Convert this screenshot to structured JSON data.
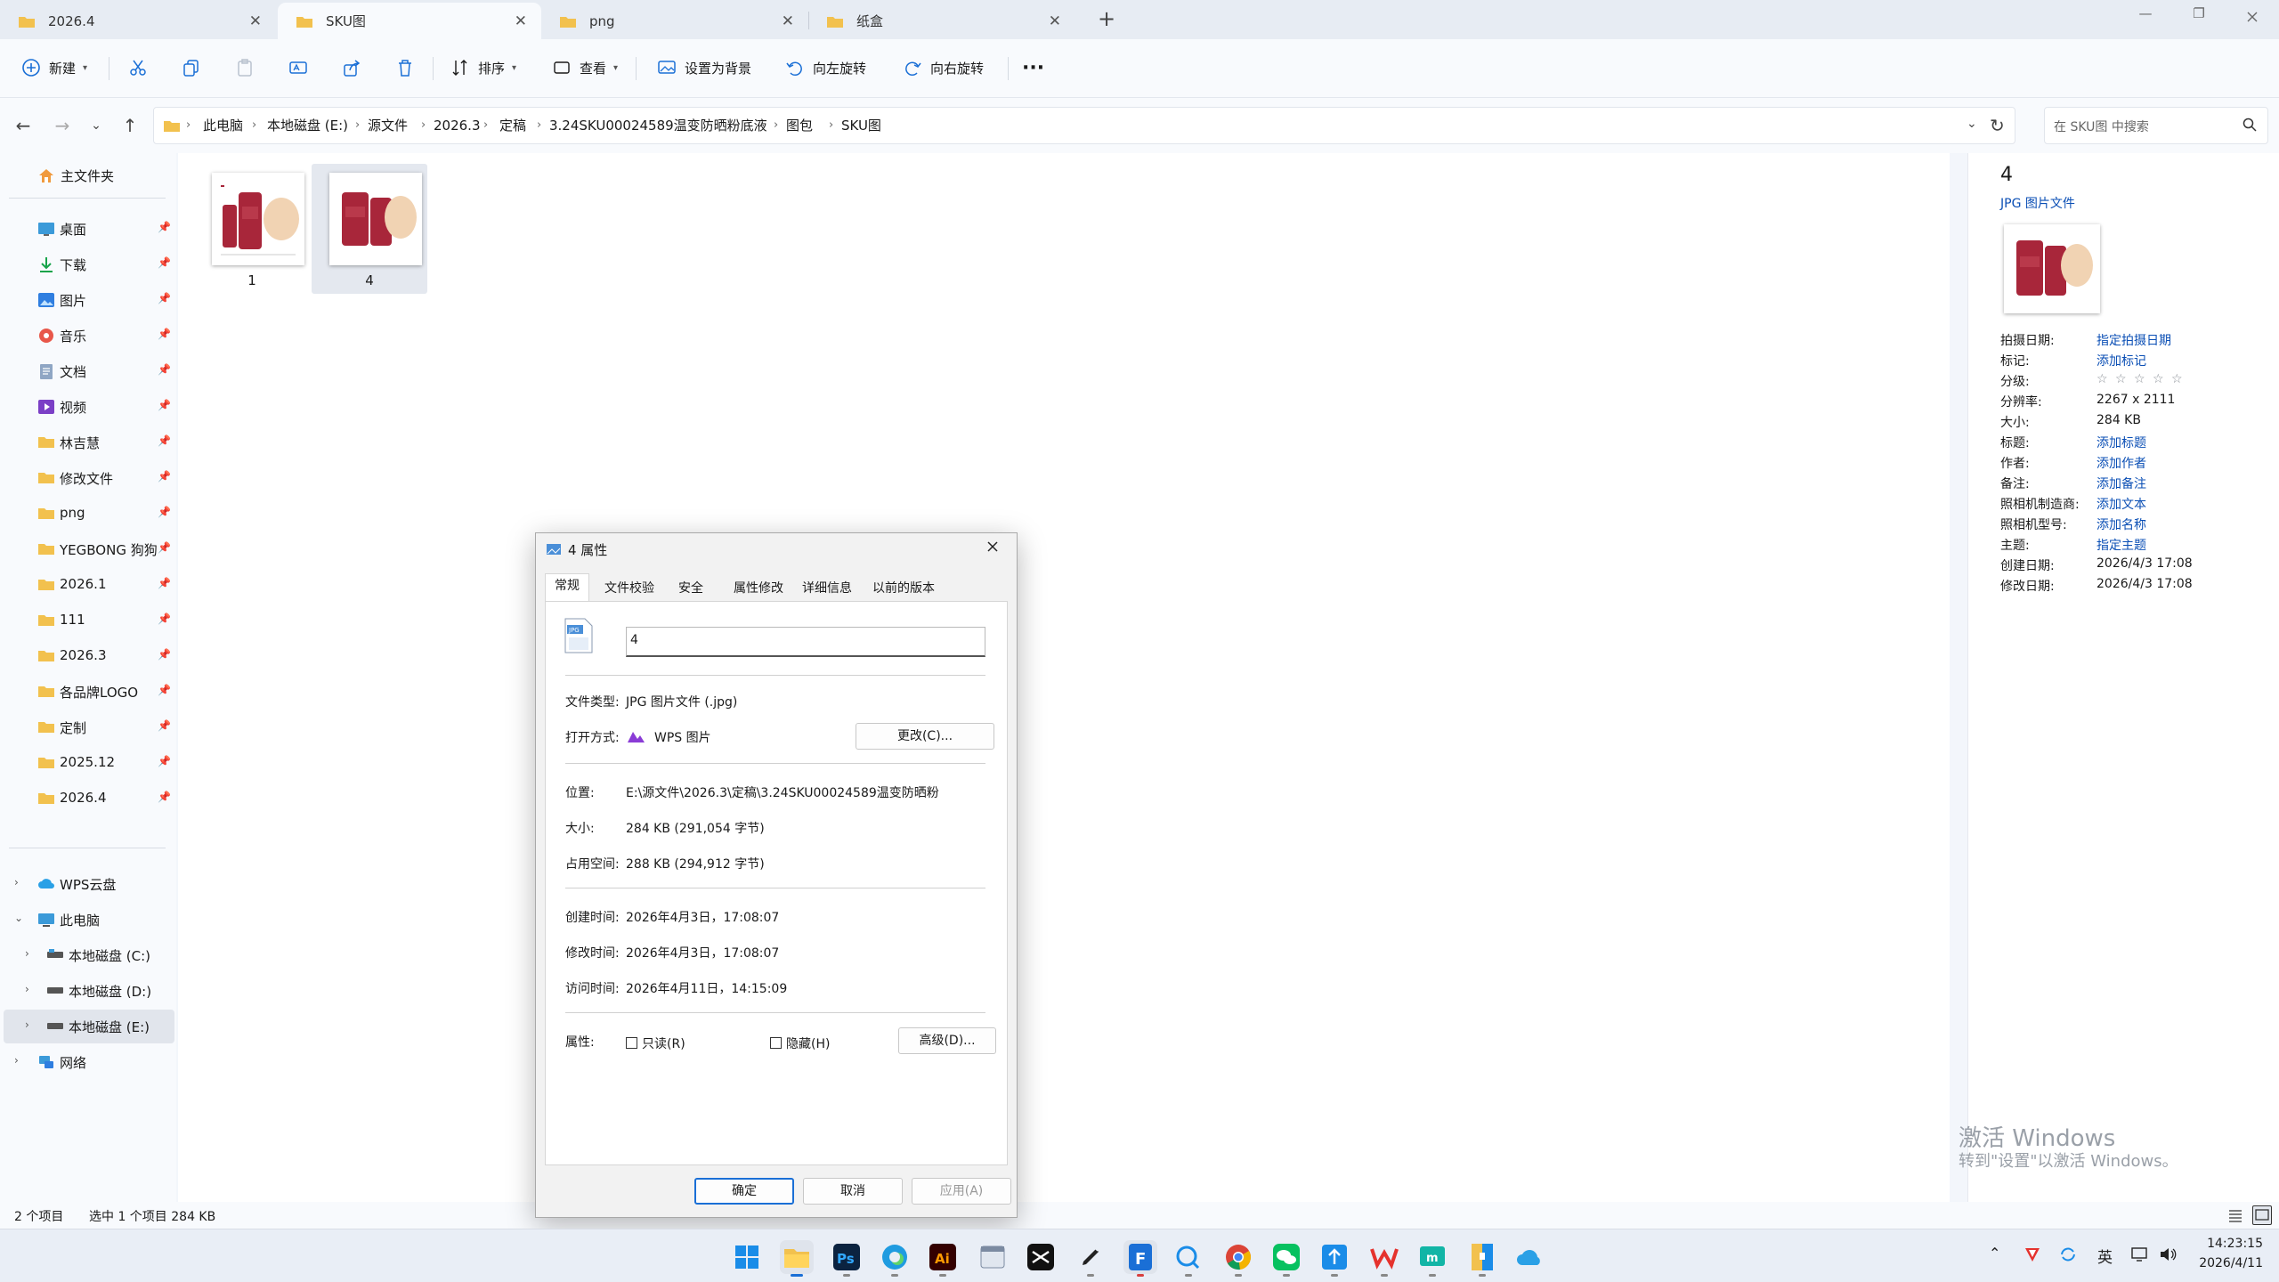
{
  "tabs": [
    {
      "label": "2026.4",
      "active": false
    },
    {
      "label": "SKU图",
      "active": true
    },
    {
      "label": "png",
      "active": false
    },
    {
      "label": "纸盒",
      "active": false
    }
  ],
  "new_tab_label": "+",
  "window": {
    "minimize": "—",
    "maximize": "❐",
    "close": ""
  },
  "toolbar": {
    "new_label": "新建",
    "sort_label": "排序",
    "view_label": "查看",
    "set_bg_label": "设置为背景",
    "rotate_left_label": "向左旋转",
    "rotate_right_label": "向右旋转",
    "more_label": "···"
  },
  "breadcrumb": [
    "此电脑",
    "本地磁盘 (E:)",
    "源文件",
    "2026.3",
    "定稿",
    "3.24SKU00024589温变防晒粉底液",
    "图包",
    "SKU图"
  ],
  "search": {
    "placeholder": "在 SKU图 中搜索"
  },
  "sidebar": {
    "home": "主文件夹",
    "quick": [
      {
        "label": "桌面",
        "icon": "desktop-icon"
      },
      {
        "label": "下载",
        "icon": "download-icon"
      },
      {
        "label": "图片",
        "icon": "pictures-icon"
      },
      {
        "label": "音乐",
        "icon": "music-icon"
      },
      {
        "label": "文档",
        "icon": "documents-icon"
      },
      {
        "label": "视频",
        "icon": "videos-icon"
      },
      {
        "label": "林吉慧",
        "icon": "folder-icon"
      },
      {
        "label": "修改文件",
        "icon": "folder-icon"
      },
      {
        "label": "png",
        "icon": "folder-icon"
      },
      {
        "label": "YEGBONG 狗狗",
        "icon": "folder-icon"
      },
      {
        "label": "2026.1",
        "icon": "folder-icon"
      },
      {
        "label": "111",
        "icon": "folder-icon"
      },
      {
        "label": "2026.3",
        "icon": "folder-icon"
      },
      {
        "label": "各品牌LOGO",
        "icon": "folder-icon"
      },
      {
        "label": "定制",
        "icon": "folder-icon"
      },
      {
        "label": "2025.12",
        "icon": "folder-icon"
      },
      {
        "label": "2026.4",
        "icon": "folder-icon"
      }
    ],
    "tree": [
      {
        "label": "WPS云盘"
      },
      {
        "label": "此电脑"
      },
      {
        "label": "本地磁盘 (C:)"
      },
      {
        "label": "本地磁盘 (D:)"
      },
      {
        "label": "本地磁盘 (E:)"
      },
      {
        "label": "网络"
      }
    ]
  },
  "files": [
    {
      "name": "1",
      "selected": false
    },
    {
      "name": "4",
      "selected": true
    }
  ],
  "details": {
    "name": "4",
    "type": "JPG 图片文件",
    "props": [
      {
        "k": "拍摄日期:",
        "v": "指定拍摄日期",
        "link": true
      },
      {
        "k": "标记:",
        "v": "添加标记",
        "link": true
      },
      {
        "k": "分级:",
        "v": "☆ ☆ ☆ ☆ ☆",
        "link": false,
        "stars": true
      },
      {
        "k": "分辨率:",
        "v": "2267 x 2111",
        "link": false
      },
      {
        "k": "大小:",
        "v": "284 KB",
        "link": false
      },
      {
        "k": "标题:",
        "v": "添加标题",
        "link": true
      },
      {
        "k": "作者:",
        "v": "添加作者",
        "link": true
      },
      {
        "k": "备注:",
        "v": "添加备注",
        "link": true
      },
      {
        "k": "照相机制造商:",
        "v": "添加文本",
        "link": true
      },
      {
        "k": "照相机型号:",
        "v": "添加名称",
        "link": true
      },
      {
        "k": "主题:",
        "v": "指定主题",
        "link": true
      },
      {
        "k": "创建日期:",
        "v": "2026/4/3 17:08",
        "link": false
      },
      {
        "k": "修改日期:",
        "v": "2026/4/3 17:08",
        "link": false
      }
    ]
  },
  "status": {
    "count": "2 个项目",
    "selection": "选中 1 个项目  284 KB"
  },
  "watermark": {
    "line1": "激活 Windows",
    "line2": "转到\"设置\"以激活 Windows。"
  },
  "dialog": {
    "title": "4 属性",
    "tabs": [
      "常规",
      "文件校验",
      "安全",
      "属性修改",
      "详细信息",
      "以前的版本"
    ],
    "filename": "4",
    "file_type_label": "文件类型:",
    "file_type": "JPG 图片文件 (.jpg)",
    "open_with_label": "打开方式:",
    "open_with": "WPS 图片",
    "change_button": "更改(C)...",
    "location_label": "位置:",
    "location": "E:\\源文件\\2026.3\\定稿\\3.24SKU00024589温变防晒粉",
    "size_label": "大小:",
    "size": "284 KB (291,054 字节)",
    "disk_size_label": "占用空间:",
    "disk_size": "288 KB (294,912 字节)",
    "created_label": "创建时间:",
    "created": "2026年4月3日，17:08:07",
    "modified_label": "修改时间:",
    "modified": "2026年4月3日，17:08:07",
    "accessed_label": "访问时间:",
    "accessed": "2026年4月11日，14:15:09",
    "attr_label": "属性:",
    "readonly_label": "只读(R)",
    "hidden_label": "隐藏(H)",
    "advanced_button": "高级(D)...",
    "ok_button": "确定",
    "cancel_button": "取消",
    "apply_button": "应用(A)"
  },
  "tray": {
    "ime": "英",
    "time": "14:23:15",
    "date": "2026/4/11"
  },
  "colors": {
    "accent": "#1a6fd6",
    "folder": "#f2c14e",
    "product_red": "#a8263a",
    "link": "#0b4fb5"
  }
}
